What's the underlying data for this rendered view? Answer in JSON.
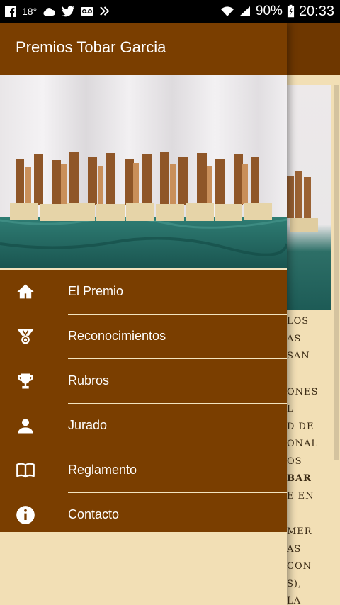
{
  "status_bar": {
    "temperature": "18°",
    "battery": "90%",
    "time": "20:33",
    "icons": [
      "facebook-icon",
      "cloud-icon",
      "twitter-icon",
      "voicemail-icon",
      "download-icon",
      "wifi-icon",
      "signal-icon",
      "battery-icon"
    ]
  },
  "drawer": {
    "title": "Premios Tobar Garcia",
    "items": [
      {
        "label": "El Premio",
        "icon": "home-icon"
      },
      {
        "label": "Reconocimientos",
        "icon": "medal-icon"
      },
      {
        "label": "Rubros",
        "icon": "trophy-icon"
      },
      {
        "label": "Jurado",
        "icon": "person-icon"
      },
      {
        "label": "Reglamento",
        "icon": "book-icon"
      },
      {
        "label": "Contacto",
        "icon": "info-icon"
      }
    ]
  },
  "background_page": {
    "text_lines": [
      "LOS",
      "AS",
      "SAN",
      "ONES",
      "L",
      "D DE",
      "ONAL",
      "OS",
      "BAR",
      "E EN",
      "MER",
      "AS",
      "CON",
      "S),",
      "LA"
    ]
  },
  "colors": {
    "drawer_header": "#7a3e00",
    "menu_background": "#7a3e00",
    "page_background": "#f2dfb5",
    "app_bar": "#6e3700"
  }
}
